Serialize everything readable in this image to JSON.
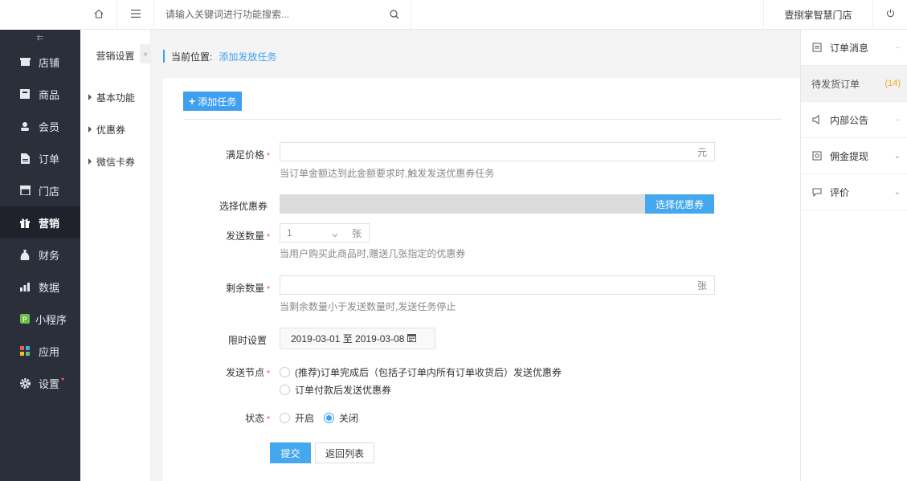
{
  "topbar": {
    "search_placeholder": "请输入关键词进行功能搜索...",
    "store_name": "壹捌掌智慧门店"
  },
  "sidebar": {
    "collapse_glyph": "⇇",
    "items": [
      {
        "label": "店铺",
        "icon": "store-icon"
      },
      {
        "label": "商品",
        "icon": "goods-icon"
      },
      {
        "label": "会员",
        "icon": "member-icon"
      },
      {
        "label": "订单",
        "icon": "order-icon"
      },
      {
        "label": "门店",
        "icon": "shop-icon"
      },
      {
        "label": "营销",
        "icon": "gift-icon",
        "active": true
      },
      {
        "label": "财务",
        "icon": "money-bag-icon"
      },
      {
        "label": "数据",
        "icon": "bar-chart-icon"
      },
      {
        "label": "小程序",
        "icon": "miniapp-icon"
      },
      {
        "label": "应用",
        "icon": "apps-icon"
      },
      {
        "label": "设置",
        "icon": "gear-icon",
        "badge": "•"
      }
    ]
  },
  "subnav": {
    "title": "营销设置",
    "fold_glyph": "«",
    "items": [
      {
        "label": "基本功能"
      },
      {
        "label": "优惠券"
      },
      {
        "label": "微信卡券"
      }
    ]
  },
  "breadcrumb": {
    "prefix": "当前位置:",
    "current": "添加发放任务"
  },
  "form": {
    "add_task_label": "添加任务",
    "price_label": "满足价格",
    "price_value": "",
    "price_suffix": "元",
    "price_hint": "当订单金额达到此金额要求时,触发发送优惠券任务",
    "coupon_label": "选择优惠券",
    "coupon_button": "选择优惠券",
    "send_count_label": "发送数量",
    "send_count_value": "1",
    "send_count_suffix": "张",
    "send_count_hint": "当用户购买此商品时,赠送几张指定的优惠券",
    "remain_label": "剩余数量",
    "remain_value": "",
    "remain_suffix": "张",
    "remain_hint": "当剩余数量小于发送数量时,发送任务停止",
    "time_label": "限时设置",
    "time_value": "2019-03-01 至 2019-03-08",
    "node_label": "发送节点",
    "node_options": [
      "(推荐)订单完成后（包括子订单内所有订单收货后）发送优惠券",
      "订单付款后发送优惠券"
    ],
    "status_label": "状态",
    "status_options": [
      {
        "label": "开启",
        "checked": false
      },
      {
        "label": "关闭",
        "checked": true
      }
    ],
    "submit_label": "提交",
    "back_label": "返回列表",
    "required_mark": "*"
  },
  "rightpanel": {
    "items": [
      {
        "label": "订单消息",
        "icon": "message-icon",
        "more": "··"
      },
      {
        "label": "待发货订单",
        "count": "(14)"
      },
      {
        "label": "内部公告",
        "icon": "speaker-icon",
        "more": "··"
      },
      {
        "label": "佣金提现",
        "icon": "withdraw-icon",
        "more": "⌄"
      },
      {
        "label": "评价",
        "icon": "comment-icon",
        "more": "⌄"
      }
    ]
  },
  "colors": {
    "accent": "#3fa0f0",
    "sidebar_bg": "#2b2f3a",
    "required": "#e4393c",
    "count": "#f5a623"
  }
}
